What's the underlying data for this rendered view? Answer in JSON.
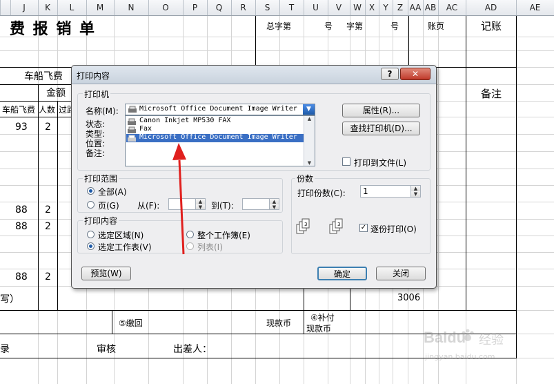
{
  "columns": [
    "J",
    "K",
    "L",
    "M",
    "N",
    "O",
    "P",
    "Q",
    "R",
    "S",
    "T",
    "U",
    "V",
    "W",
    "X",
    "Y",
    "Z",
    "AA",
    "AB",
    "AC",
    "AD",
    "AE"
  ],
  "sheet": {
    "title": "费 报 销 单",
    "total_no": "总字第",
    "no1": "号",
    "char_no": "字第",
    "no2": "号",
    "page": "账页",
    "booking": "记账",
    "fare_header": "车船飞费",
    "amount_header": "金额",
    "remark_header": "备注",
    "fare_col": "车船飞费",
    "people_col": "人数",
    "toll_col": "过路",
    "rows": [
      {
        "fare": "93",
        "people": "2"
      },
      {
        "fare": "88",
        "people": "2"
      },
      {
        "fare": "88",
        "people": "2"
      },
      {
        "fare": "88",
        "people": "2"
      }
    ],
    "uppercase_label": "写）",
    "total_value": "3006",
    "supplement": "④补付",
    "cash1": "现款币",
    "refund": "⑤缴回",
    "cash2": "现款币",
    "record": "录",
    "audit": "审核",
    "traveler": "出差人："
  },
  "dialog": {
    "title": "打印内容",
    "help": "?",
    "close": "✕",
    "printer_group": "打印机",
    "name_label": "名称(M):",
    "selected_printer": "Microsoft Office Document Image Writer",
    "printers": [
      {
        "name": "Canon Inkjet MP530 FAX",
        "selected": false
      },
      {
        "name": "Fax",
        "selected": false
      },
      {
        "name": "Microsoft Office Document Image Writer",
        "selected": true
      }
    ],
    "status_label": "状态:",
    "type_label": "类型:",
    "where_label": "位置:",
    "comment_label": "备注:",
    "properties_btn": "属性(R)...",
    "find_printer_btn": "查找打印机(D)...",
    "print_to_file": "打印到文件(L)",
    "range_group": "打印范围",
    "range_all": "全部(A)",
    "range_pages": "页(G)",
    "from_label": "从(F):",
    "to_label": "到(T):",
    "copies_group": "份数",
    "copies_label": "打印份数(C):",
    "copies_value": "1",
    "collate": "逐份打印(O)",
    "collate_checked": true,
    "content_group": "打印内容",
    "sel_area": "选定区域(N)",
    "whole_workbook": "整个工作簿(E)",
    "sel_sheet": "选定工作表(V)",
    "list": "列表(I)",
    "preview_btn": "预览(W)",
    "ok_btn": "确定",
    "close_btn": "关闭"
  },
  "watermark": {
    "brand": "Baidu",
    "sub": "经验",
    "url": "jingyan.baidu.com"
  },
  "colors": {
    "accent": "#1e5aa8",
    "selection": "#3a6fc4",
    "arrow": "#e0201e"
  }
}
